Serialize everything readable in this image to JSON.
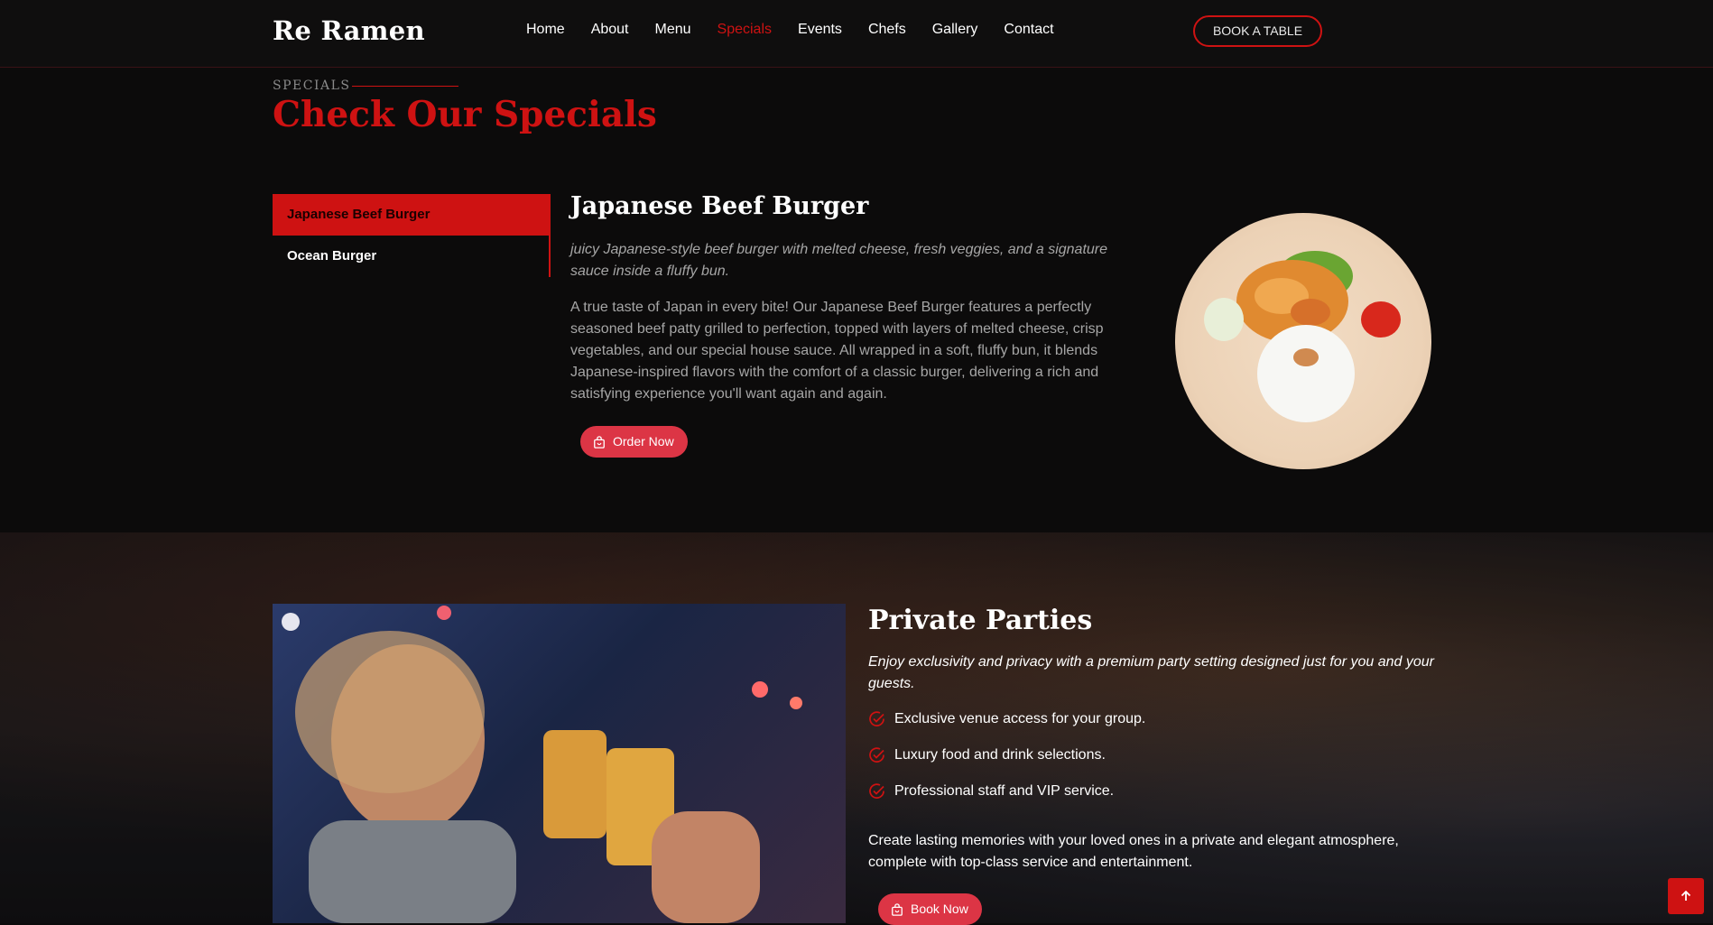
{
  "header": {
    "logo": "Re Ramen",
    "nav": [
      "Home",
      "About",
      "Menu",
      "Specials",
      "Events",
      "Chefs",
      "Gallery",
      "Contact"
    ],
    "active_nav": "Specials",
    "book_table": "BOOK A TABLE"
  },
  "specials": {
    "label": "SPECIALS",
    "title": "Check Our Specials",
    "tabs": [
      "Japanese Beef Burger",
      "Ocean Burger"
    ],
    "dish": {
      "title": "Japanese Beef Burger",
      "tagline": "juicy Japanese-style beef burger with melted cheese, fresh veggies, and a signature sauce inside a fluffy bun.",
      "description": "A true taste of Japan in every bite! Our Japanese Beef Burger features a perfectly seasoned beef patty grilled to perfection, topped with layers of melted cheese, crisp vegetables, and our special house sauce. All wrapped in a soft, fluffy bun, it blends Japanese-inspired flavors with the comfort of a classic burger, delivering a rich and satisfying experience you'll want again and again.",
      "order_button": "Order Now"
    }
  },
  "parties": {
    "title": "Private Parties",
    "tagline": "Enjoy exclusivity and privacy with a premium party setting designed just for you and your guests.",
    "features": [
      "Exclusive venue access for your group.",
      "Luxury food and drink selections.",
      "Professional staff and VIP service."
    ],
    "description": "Create lasting memories with your loved ones in a private and elegant atmosphere, complete with top-class service and entertainment.",
    "book_button": "Book Now"
  },
  "colors": {
    "accent": "#ce1212",
    "button": "#dc3545",
    "bg": "#0c0b0b"
  },
  "icons": [
    "shopping-bag-icon",
    "check-circle-icon",
    "arrow-up-icon"
  ]
}
